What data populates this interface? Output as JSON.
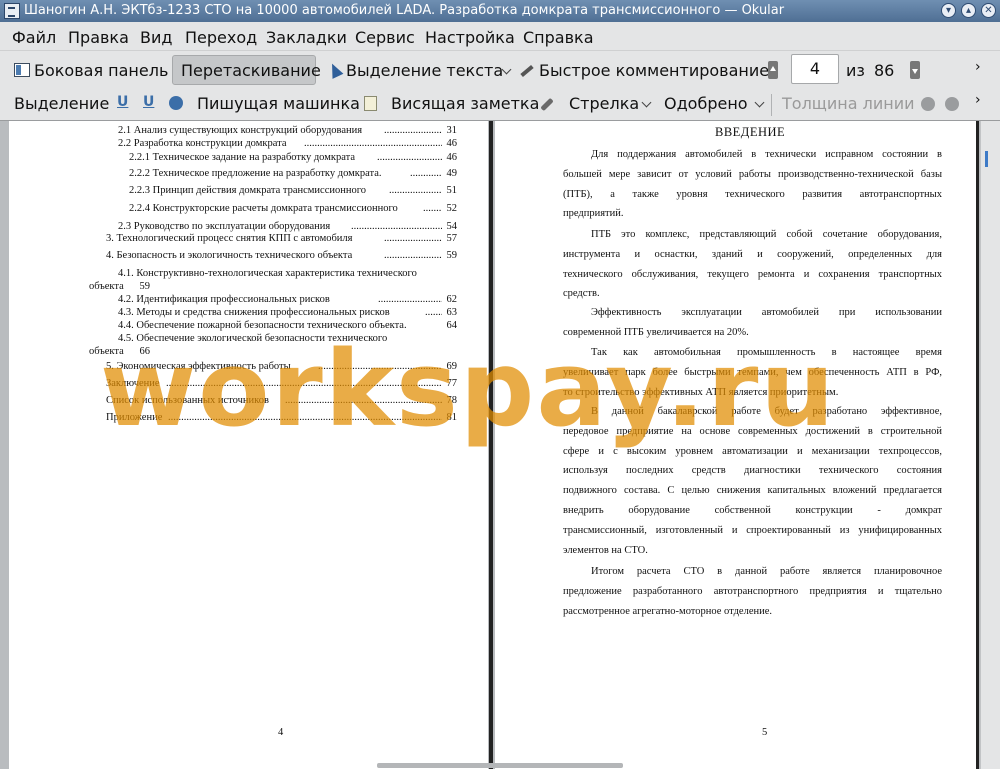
{
  "window": {
    "title": "Шаногин А.Н. ЭКТбз-1233 СТО на 10000 автомобилей LADA. Разработка домкрата трансмиссионного  — Okular",
    "controls": [
      "minimize",
      "maximize",
      "close"
    ]
  },
  "menu": [
    "Файл",
    "Правка",
    "Вид",
    "Переход",
    "Закладки",
    "Сервис",
    "Настройка",
    "Справка"
  ],
  "toolbar1": {
    "sidebar": "Боковая панель",
    "drag": "Перетаскивание",
    "text_select": "Выделение текста",
    "quick_comment": "Быстрое комментирование",
    "page_current": "4",
    "page_of": "из",
    "page_total": "86"
  },
  "toolbar2": {
    "selection": "Выделение",
    "typewriter": "Пишущая машинка",
    "sticky_note": "Висящая заметка",
    "arrow": "Стрелка",
    "stamp": "Одобрено",
    "line_width": "Толщина линии"
  },
  "left_page": {
    "toc": [
      {
        "text": "2.1 Анализ существующих конструкций оборудования",
        "page": "31"
      },
      {
        "text": "2.2 Разработка конструкции домкрата",
        "page": "46"
      },
      {
        "text": "2.2.1 Техническое задание на разработку домкрата",
        "page": "46"
      },
      {
        "text": "2.2.2 Техническое предложение на разработку домкрата.",
        "page": "49"
      },
      {
        "text": "2.2.3 Принцип действия домкрата трансмиссионного",
        "page": "51"
      },
      {
        "text": "2.2.4 Конструкторские расчеты домкрата трансмиссионного",
        "page": "52"
      },
      {
        "text": "2.3 Руководство по эксплуатации оборудования",
        "page": "54"
      },
      {
        "text": "3.    Технологический процесс снятия КПП с автомобиля",
        "page": "57"
      },
      {
        "text": "4.    Безопасность и экологичность технического объекта",
        "page": "59"
      },
      {
        "text": "4.1.      Конструктивно-технологическая характеристика технического",
        "cont": "объекта",
        "page": "59"
      },
      {
        "text": "4.2.      Идентификация профессиональных рисков",
        "page": "62"
      },
      {
        "text": "4.3.      Методы и средства снижения профессиональных рисков",
        "page": "63"
      },
      {
        "text": "4.4.      Обеспечение пожарной безопасности технического объекта.",
        "page": "64"
      },
      {
        "text": "4.5.      Обеспечение      экологической      безопасности      технического",
        "cont": "объекта",
        "page": "66"
      },
      {
        "text": "5.   Экономическая эффективность работы",
        "page": "69"
      },
      {
        "text": "Заключение",
        "page": "77"
      },
      {
        "text": "Список использованных источников",
        "page": "78"
      },
      {
        "text": "Приложение",
        "page": "81"
      }
    ],
    "page_number": "4"
  },
  "right_page": {
    "heading": "ВВЕДЕНИЕ",
    "paragraphs": [
      [
        "Для поддержания автомобилей в технически исправном состоянии в",
        "большей мере зависит от условий работы производственно-технической базы",
        "(ПТБ),   а   также   уровня   технического   развития   автотранспортных",
        "предприятий."
      ],
      [
        "ПТБ это комплекс, представляющий собой сочетание оборудования,",
        "инструмента   и   оснастки,   зданий   и   сооружений,   определенных   для",
        "технического обслуживания, текущего ремонта и сохранения транспортных",
        "средств."
      ],
      [
        "Эффективность    эксплуатации    автомобилей    при    использовании",
        "современной ПТБ увеличивается на 20%."
      ],
      [
        "Так   как   автомобильная   промышленность   в   настоящее   время",
        "увеличивает парк более быстрыми темпами, чем обеспеченность АТП в РФ,",
        "то строительство эффективных АТП является приоритетным."
      ],
      [
        "В   данной   бакалаврской   работе   будет   разработано   эффективное,",
        "передовое предприятие на основе современных достижений в строительной",
        "сфере  и  с  высоким  уровнем  автоматизации  и  механизации  техпроцессов,",
        "используя    последних    средств    диагностики    технического    состояния",
        "подвижного состава. С целью снижения капитальных вложений предлагается",
        "внедрить       оборудование       собственной       конструкции       -       домкрат",
        "трансмиссионный, изготовленный и спроектированный из унифицированных",
        "элементов на СТО."
      ],
      [
        "Итогом   расчета   СТО   в   данной   работе   является   планировочное",
        "предложение разработанного автотранспортного предприятия и тщательно",
        "рассмотренное агрегатно-моторное отделение."
      ]
    ],
    "page_number": "5"
  },
  "watermark": "workspay.ru",
  "colors": {
    "titlebar": "#5a7aa0",
    "toolbar": "#e4e5e6",
    "watermark": "#e08c00",
    "accent": "#3d7ac7"
  }
}
